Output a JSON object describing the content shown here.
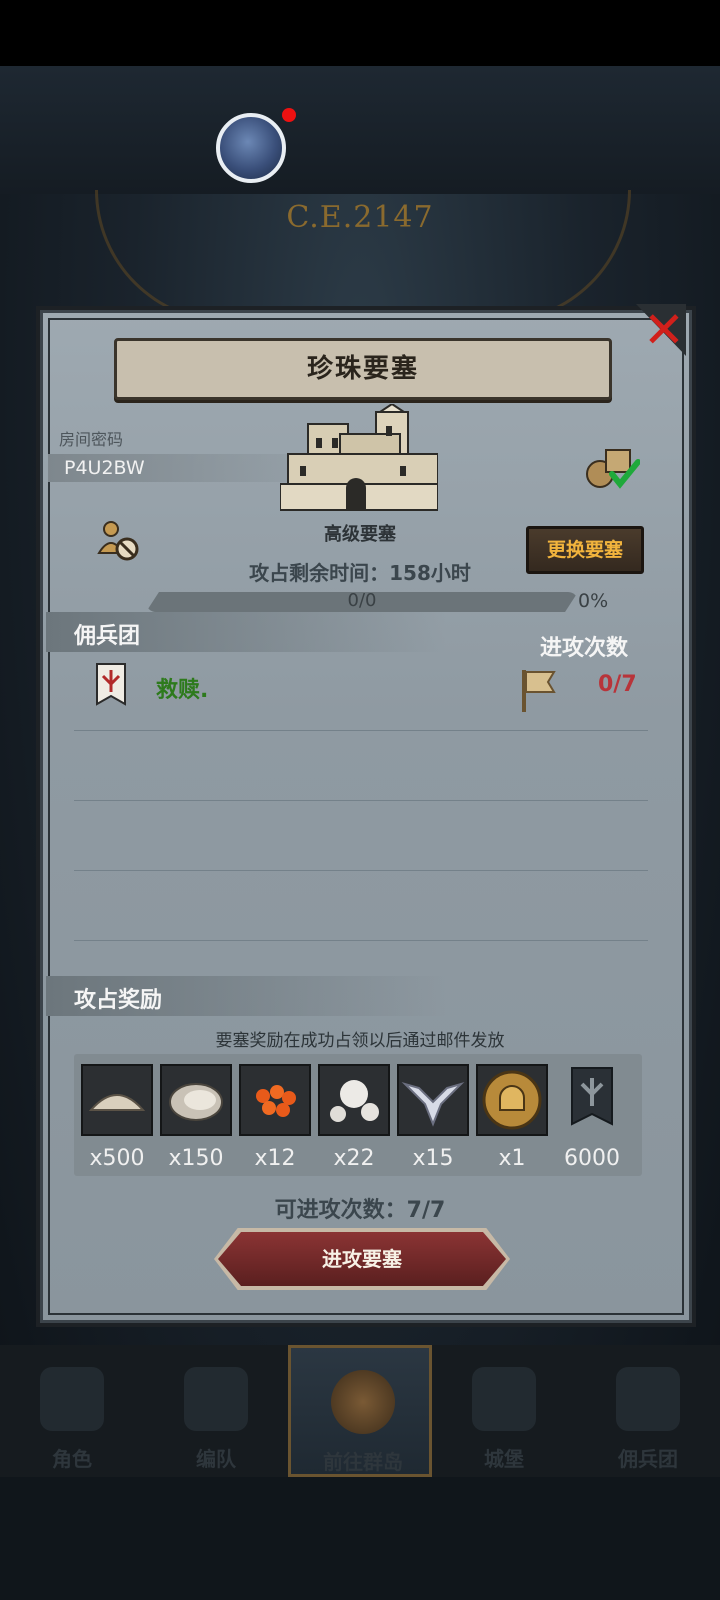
{
  "header": {
    "era": "C.E.2147"
  },
  "dialog": {
    "title": "珍珠要塞",
    "room_label": "房间密码",
    "room_code": "P4U2BW",
    "castle_name": "高级要塞",
    "change_button": "更换要塞",
    "time_remaining": "攻占剩余时间：158小时",
    "progress_text": "0/0",
    "progress_percent": "0%",
    "progress_fraction": 0,
    "guild_section_title": "佣兵团",
    "attacks_column_title": "进攻次数",
    "guilds": [
      {
        "name": "救赎.",
        "attacks": "0/7"
      }
    ],
    "reward_section_title": "攻占奖励",
    "reward_note": "要塞奖励在成功占领以后通过邮件发放",
    "rewards": [
      {
        "icon": "sand-icon",
        "qty": "x500"
      },
      {
        "icon": "oyster-icon",
        "qty": "x150"
      },
      {
        "icon": "fish-roe-icon",
        "qty": "x12"
      },
      {
        "icon": "pearl-icon",
        "qty": "x22"
      },
      {
        "icon": "wings-emblem-icon",
        "qty": "x15"
      },
      {
        "icon": "helmet-coin-icon",
        "qty": "x1"
      },
      {
        "icon": "guild-banner-icon",
        "qty": "6000"
      }
    ],
    "attacks_available": "可进攻次数：7/7",
    "attack_button": "进攻要塞",
    "close_icon": "close-icon"
  },
  "nav": {
    "tabs": [
      {
        "label": "角色",
        "icon": "knight-icon"
      },
      {
        "label": "编队",
        "icon": "helmet-icon"
      },
      {
        "label": "前往群岛",
        "icon": "islands-icon",
        "active": true
      },
      {
        "label": "城堡",
        "icon": "castle-icon"
      },
      {
        "label": "佣兵团",
        "icon": "mercenary-icon"
      }
    ]
  },
  "colors": {
    "accent_gold": "#f2b43d",
    "guild_green": "#2d7a1c",
    "attack_red": "#b8343a",
    "close_red": "#d1201b"
  }
}
